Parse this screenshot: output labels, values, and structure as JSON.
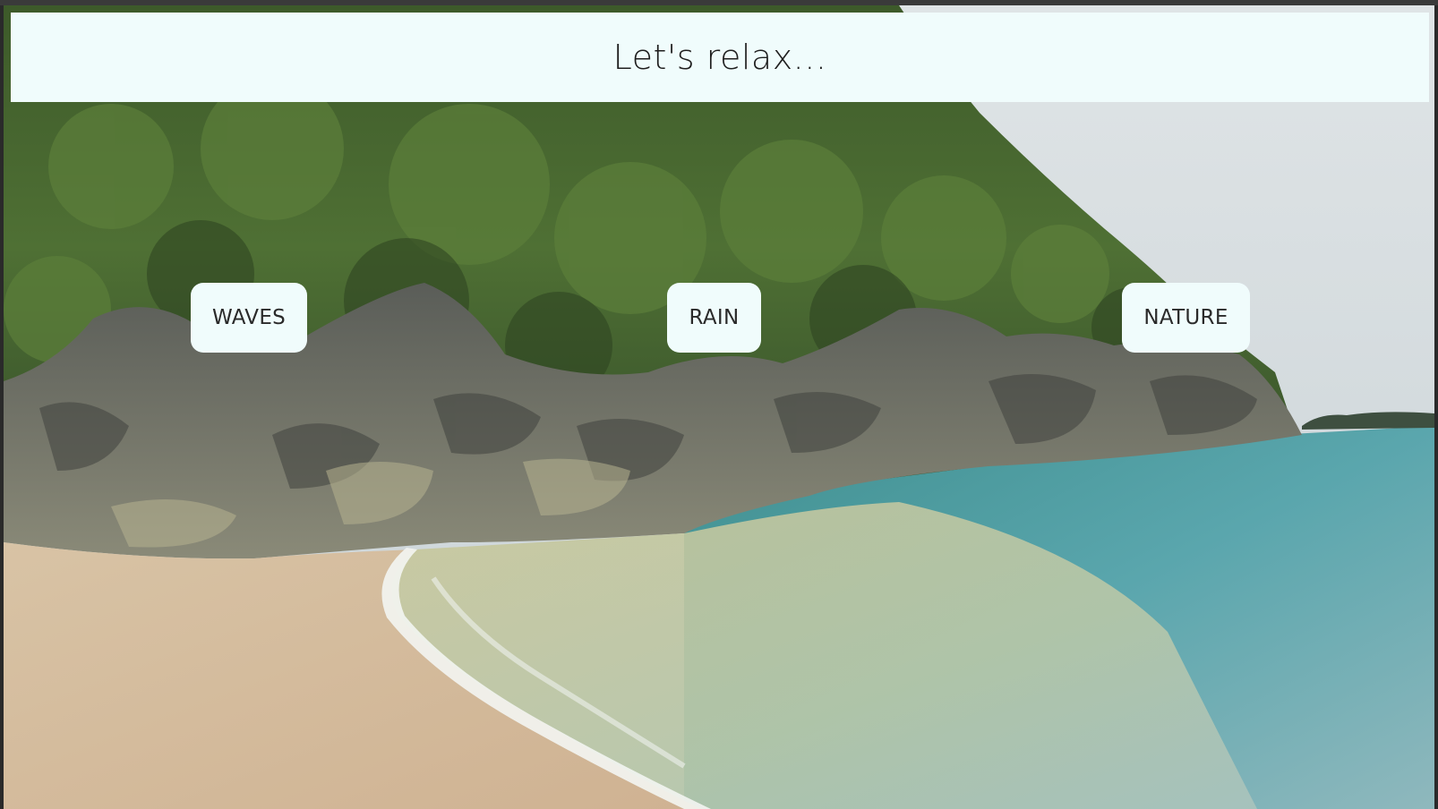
{
  "page": {
    "title": "Let's relax..."
  },
  "background": {
    "scene": "beach-with-rocky-forested-cliff-and-sea"
  },
  "buttons": [
    {
      "id": "waves",
      "label": "WAVES"
    },
    {
      "id": "rain",
      "label": "RAIN"
    },
    {
      "id": "nature",
      "label": "NATURE"
    }
  ],
  "colors": {
    "panel": "#f0fcfc",
    "text": "#1e1e1e"
  }
}
